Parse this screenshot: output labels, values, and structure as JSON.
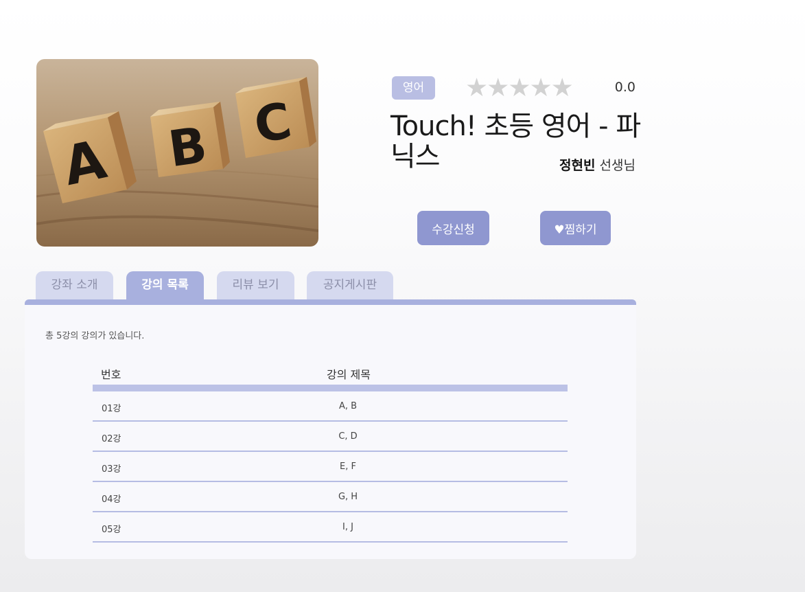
{
  "course": {
    "category": "영어",
    "rating_stars": "★★★★★",
    "rating": "0.0",
    "title": "Touch! 초등 영어 - 파닉스",
    "teacher_name": "정현빈",
    "teacher_suffix": "선생님",
    "thumbnail_letters": [
      "A",
      "B",
      "C"
    ]
  },
  "actions": {
    "enroll_label": "수강신청",
    "wishlist_label": "♥찜하기"
  },
  "tabs": [
    {
      "label": "강좌 소개",
      "active": false
    },
    {
      "label": "강의 목록",
      "active": true
    },
    {
      "label": "리뷰 보기",
      "active": false
    },
    {
      "label": "공지게시판",
      "active": false
    }
  ],
  "lecture_list": {
    "summary": "총 5강의 강의가 있습니다.",
    "headers": [
      "번호",
      "강의 제목"
    ],
    "rows": [
      {
        "no": "01강",
        "title": "A, B"
      },
      {
        "no": "02강",
        "title": "C, D"
      },
      {
        "no": "03강",
        "title": "E, F"
      },
      {
        "no": "04강",
        "title": "G, H"
      },
      {
        "no": "05강",
        "title": "I, J"
      }
    ]
  },
  "colors": {
    "accent": "#8f97d0",
    "tab_active": "#a8b0de",
    "tab_inactive": "#d5d9ef",
    "category_badge": "#b9bee3"
  }
}
